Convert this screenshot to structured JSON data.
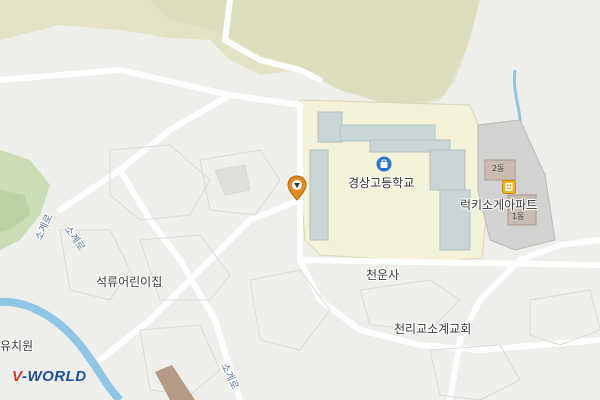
{
  "map": {
    "labels": {
      "school": "경상고등학교",
      "apartment": "럭키소게아파트",
      "temple": "천운사",
      "church": "천리교소계교회",
      "kindergarten": "석류어린이집",
      "kindergarten2": "유치원",
      "road1": "소계로",
      "road2": "소계로",
      "road3": "소계로",
      "bld_2dong": "2동",
      "bld_1dong": "1동"
    },
    "icons": {
      "school": "school-bag-icon",
      "apartment": "apartment-building-icon",
      "marker": "location-pin-icon"
    },
    "logo": {
      "prefix": "V",
      "suffix": "-WORLD"
    },
    "colors": {
      "land": "#eeeeea",
      "hill": "#e2e1c3",
      "school_ground": "#f3f1d7",
      "road_line": "#ffffff",
      "water": "#8fc6e6",
      "forest": "#c7dfb7",
      "marker": "#e58a20"
    }
  }
}
